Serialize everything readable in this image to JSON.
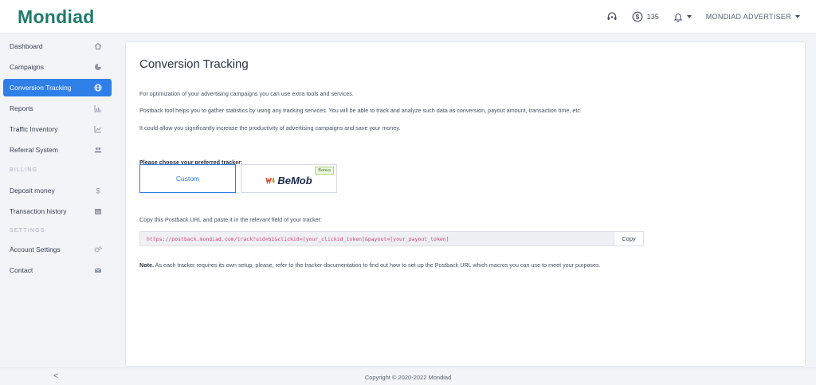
{
  "header": {
    "logo": "Mondiad",
    "balance": "135",
    "user_menu": "MONDIAD ADVERTISER"
  },
  "sidebar": {
    "items": [
      {
        "label": "Dashboard",
        "icon": "home-icon"
      },
      {
        "label": "Campaigns",
        "icon": "pie-chart-icon"
      },
      {
        "label": "Conversion Tracking",
        "icon": "globe-icon",
        "active": true
      },
      {
        "label": "Reports",
        "icon": "bar-chart-icon"
      },
      {
        "label": "Traffic Inventory",
        "icon": "line-chart-icon"
      },
      {
        "label": "Referral System",
        "icon": "users-icon"
      },
      {
        "label": "Deposit money",
        "icon": "dollar-icon"
      },
      {
        "label": "Transaction history",
        "icon": "calendar-icon"
      },
      {
        "label": "Account Settings",
        "icon": "gears-icon"
      },
      {
        "label": "Contact",
        "icon": "envelope-icon"
      }
    ],
    "sections": {
      "billing": "BILLING",
      "settings": "SETTINGS"
    }
  },
  "main": {
    "title": "Conversion Tracking",
    "paragraphs": [
      "For optimization of your advertising campaigns you can use extra tools and services.",
      "Postback tool helps you to gather statistics by using any tracking services. You will be able to track and analyze such data as conversion, payout amount, transaction time, etc.",
      "It could allow you significantly increase the productivity of advertising campaigns and save your money."
    ],
    "choose_label": "Please choose your preferred tracker:",
    "trackers": {
      "custom": "Custom",
      "bemob": "BeMob",
      "bonus": "Bonus"
    },
    "copy_label": "Copy this Postback URL and paste it in the relevant field of your tracker:",
    "postback_url": "https://postback.mondiad.com/track?uid=51&clickid=[your_clickid_token]&payout=[your_payout_token]",
    "copy_button": "Copy",
    "note_label": "Note.",
    "note_text": " As each tracker requires its own setup, please, refer to the tracker documentation to find out how to set up the Postback URL which macros you can use to meet your purposes."
  },
  "footer": {
    "collapse": "<",
    "copyright": "Copyright © 2020-2022 Mondiad"
  },
  "colors": {
    "accent": "#2f7fe8",
    "brand": "#1f7a6b",
    "url_text": "#d2427b"
  }
}
